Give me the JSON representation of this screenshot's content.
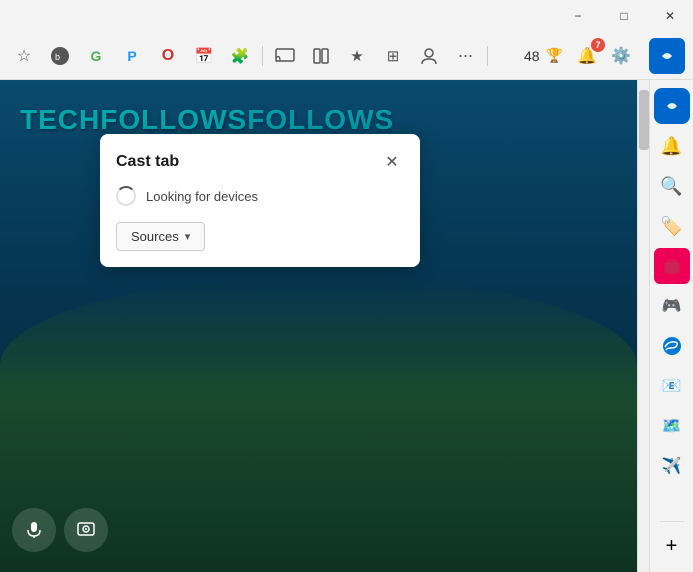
{
  "titleBar": {
    "minimizeLabel": "−",
    "maximizeLabel": "□",
    "closeLabel": "✕"
  },
  "toolbar": {
    "icons": [
      {
        "name": "bookmark-icon",
        "glyph": "☆"
      },
      {
        "name": "bing-icon",
        "glyph": "🔵"
      },
      {
        "name": "extension1-icon",
        "glyph": "G"
      },
      {
        "name": "extension2-icon",
        "glyph": "P"
      },
      {
        "name": "opera-icon",
        "glyph": "O"
      },
      {
        "name": "extension3-icon",
        "glyph": "📅"
      },
      {
        "name": "extensions-icon",
        "glyph": "🧩"
      },
      {
        "name": "cast-icon",
        "glyph": "▭"
      },
      {
        "name": "reader-icon",
        "glyph": "≡"
      },
      {
        "name": "favorites-icon",
        "glyph": "★"
      },
      {
        "name": "collections-icon",
        "glyph": "⊞"
      },
      {
        "name": "profile-icon",
        "glyph": "👤"
      },
      {
        "name": "more-icon",
        "glyph": "···"
      }
    ],
    "copilotIcon": "🔷"
  },
  "castPopup": {
    "title": "Cast tab",
    "closeButtonLabel": "✕",
    "statusText": "Looking for devices",
    "sourcesLabel": "Sources",
    "chevronLabel": "▾"
  },
  "page": {
    "logoText": "TECHFOLLOWS",
    "bgFrom": "#0a4a6e",
    "bgTo": "#0a2535"
  },
  "rightSidebar": {
    "icons": [
      {
        "name": "copilot-sidebar-icon",
        "glyph": "🔷"
      },
      {
        "name": "bell-sidebar-icon",
        "glyph": "🔔"
      },
      {
        "name": "search-sidebar-icon",
        "glyph": "🔍"
      },
      {
        "name": "tag-sidebar-icon",
        "glyph": "🏷️"
      },
      {
        "name": "briefcase-sidebar-icon",
        "glyph": "💼"
      },
      {
        "name": "figure-sidebar-icon",
        "glyph": "🧩"
      },
      {
        "name": "edge-sidebar-icon",
        "glyph": "🔷"
      },
      {
        "name": "outlook-sidebar-icon",
        "glyph": "📧"
      },
      {
        "name": "maps-sidebar-icon",
        "glyph": "🗺️"
      },
      {
        "name": "message-sidebar-icon",
        "glyph": "✈️"
      },
      {
        "name": "add-sidebar-icon",
        "glyph": "+"
      }
    ]
  },
  "headerArea": {
    "score": "48",
    "trophyIcon": "🏆",
    "notificationIcon": "🔔",
    "notificationCount": "7",
    "settingsIcon": "⚙️"
  },
  "overlayControls": {
    "micIcon": "🎤",
    "cameraIcon": "⊙"
  }
}
